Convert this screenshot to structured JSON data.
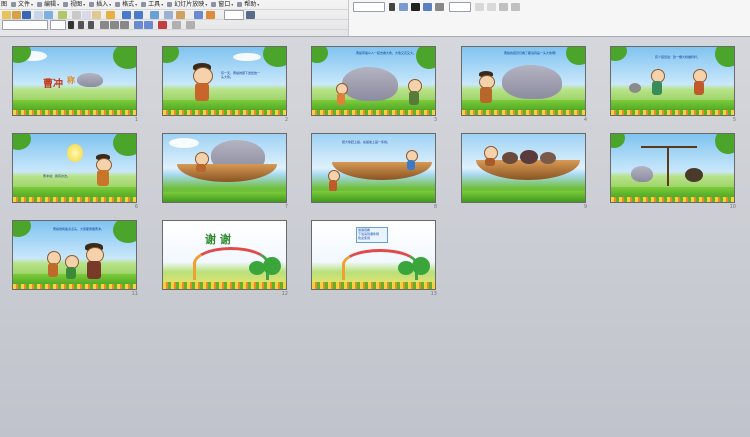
{
  "menu": [
    {
      "label": "文件"
    },
    {
      "label": "编辑"
    },
    {
      "label": "视图"
    },
    {
      "label": "插入"
    },
    {
      "label": "格式"
    },
    {
      "label": "工具"
    },
    {
      "label": "幻灯片放映"
    },
    {
      "label": "窗口"
    },
    {
      "label": "帮助"
    }
  ],
  "menu_prefix": "图",
  "slides": [
    {
      "num": "1",
      "title_a": "曹冲",
      "title_b": "称"
    },
    {
      "num": "2",
      "caption": "有一天，曹操的部下送给他一头大象。"
    },
    {
      "num": "3",
      "caption": "曹操带着众人一起去看大象，大象又高又大。"
    },
    {
      "num": "4",
      "caption": "曹操的官员们看了都说真是一头大象啊！"
    },
    {
      "num": "5",
      "caption": "有个官员说：砍一棵大树做秤杆。"
    },
    {
      "num": "6",
      "caption": "曹冲说：我有办法。"
    },
    {
      "num": "7"
    },
    {
      "num": "8",
      "caption": "把大象赶上船，在船舷上画一条线。"
    },
    {
      "num": "9"
    },
    {
      "num": "10"
    },
    {
      "num": "11",
      "caption": "曹操微笑着点点头，大家都佩服曹冲。"
    },
    {
      "num": "12",
      "thanks": "谢  谢"
    },
    {
      "num": "13",
      "lines": [
        "谢谢观看",
        "下载请到课件网",
        "欢迎使用"
      ]
    }
  ],
  "colors": {
    "accent": "#2b62c8",
    "thanks": "#2e8b2e"
  }
}
